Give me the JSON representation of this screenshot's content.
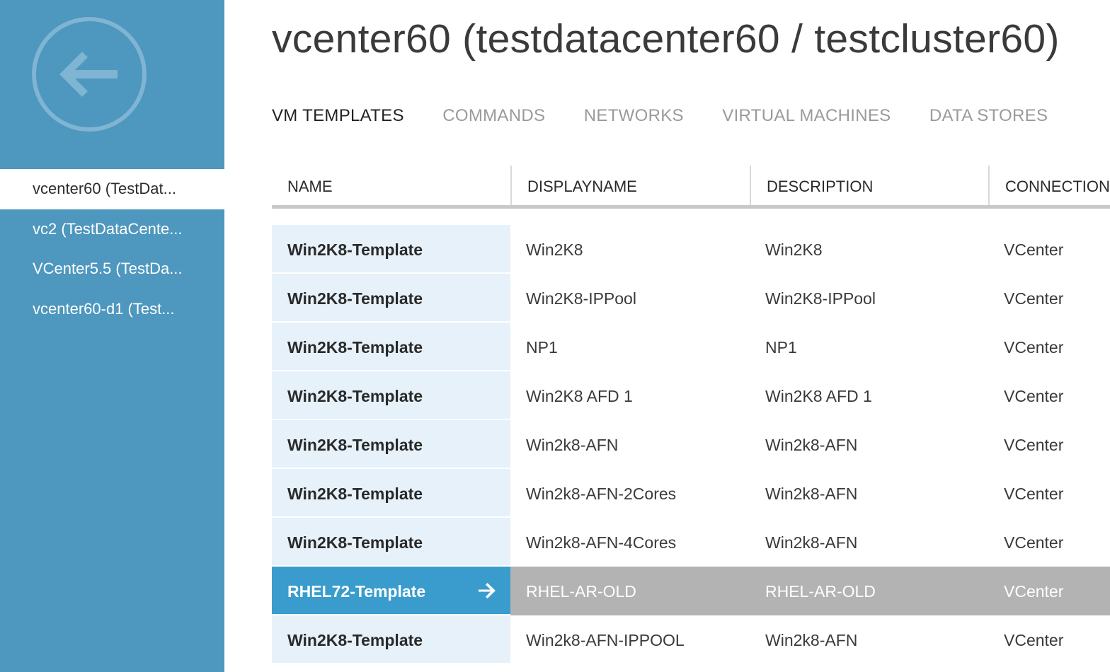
{
  "sidebar": {
    "items": [
      {
        "label": "vcenter60 (TestDat...",
        "selected": true
      },
      {
        "label": "vc2 (TestDataCente...",
        "selected": false
      },
      {
        "label": "VCenter5.5 (TestDa...",
        "selected": false
      },
      {
        "label": "vcenter60-d1 (Test...",
        "selected": false
      }
    ]
  },
  "header": {
    "title": "vcenter60 (testdatacenter60 / testcluster60)"
  },
  "tabs": [
    {
      "label": "VM TEMPLATES",
      "active": true
    },
    {
      "label": "COMMANDS",
      "active": false
    },
    {
      "label": "NETWORKS",
      "active": false
    },
    {
      "label": "VIRTUAL MACHINES",
      "active": false
    },
    {
      "label": "DATA STORES",
      "active": false
    }
  ],
  "table": {
    "columns": [
      "NAME",
      "DISPLAYNAME",
      "DESCRIPTION",
      "CONNECTION"
    ],
    "rows": [
      {
        "name": "Win2K8-Template",
        "displayname": "Win2K8",
        "description": "Win2K8",
        "connection": "VCenter",
        "selected": false
      },
      {
        "name": "Win2K8-Template",
        "displayname": "Win2K8-IPPool",
        "description": "Win2K8-IPPool",
        "connection": "VCenter",
        "selected": false
      },
      {
        "name": "Win2K8-Template",
        "displayname": "NP1",
        "description": "NP1",
        "connection": "VCenter",
        "selected": false
      },
      {
        "name": "Win2K8-Template",
        "displayname": "Win2K8 AFD 1",
        "description": "Win2K8 AFD 1",
        "connection": "VCenter",
        "selected": false
      },
      {
        "name": "Win2K8-Template",
        "displayname": "Win2k8-AFN",
        "description": "Win2k8-AFN",
        "connection": "VCenter",
        "selected": false
      },
      {
        "name": "Win2K8-Template",
        "displayname": "Win2k8-AFN-2Cores",
        "description": "Win2k8-AFN",
        "connection": "VCenter",
        "selected": false
      },
      {
        "name": "Win2K8-Template",
        "displayname": "Win2k8-AFN-4Cores",
        "description": "Win2k8-AFN",
        "connection": "VCenter",
        "selected": false
      },
      {
        "name": "RHEL72-Template",
        "displayname": "RHEL-AR-OLD",
        "description": "RHEL-AR-OLD",
        "connection": "VCenter",
        "selected": true
      },
      {
        "name": "Win2K8-Template",
        "displayname": "Win2k8-AFN-IPPOOL",
        "description": "Win2k8-AFN",
        "connection": "VCenter",
        "selected": false
      }
    ]
  },
  "colors": {
    "sidebar": "#4e97be",
    "name_cell": "#e6f1fa",
    "selected_name": "#3a9ccd",
    "selected_row": "#b3b3b3"
  },
  "icons": {
    "back": "back-arrow-icon",
    "row_open": "arrow-right-icon"
  }
}
